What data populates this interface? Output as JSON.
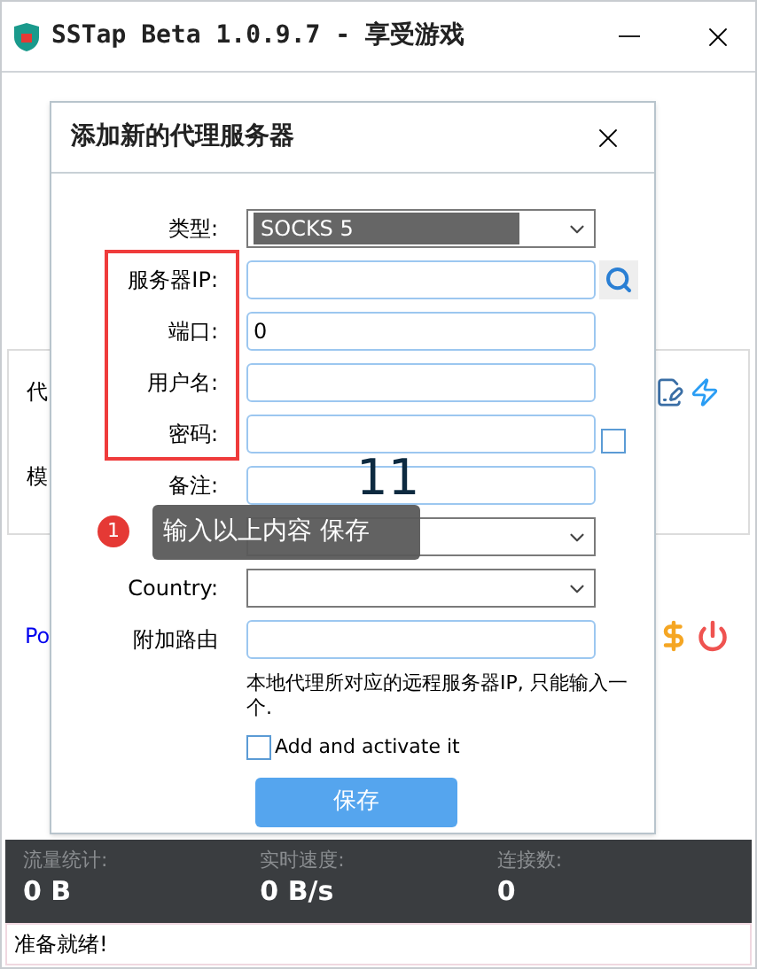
{
  "window": {
    "title": "SSTap Beta 1.0.9.7 - 享受游戏"
  },
  "main": {
    "proxy_label": "代",
    "mode_label": "模",
    "link_text": "Po"
  },
  "dialog": {
    "title": "添加新的代理服务器",
    "fields": [
      {
        "kind": "select",
        "label": "类型:",
        "value": "SOCKS 5",
        "focused": true
      },
      {
        "kind": "search",
        "label": "服务器IP:"
      },
      {
        "kind": "input",
        "label": "端口:",
        "value": "0"
      },
      {
        "kind": "input",
        "label": "用户名:"
      },
      {
        "kind": "password",
        "label": "密码:",
        "checked": false
      },
      {
        "kind": "input",
        "label": "备注:"
      },
      {
        "kind": "select"
      },
      {
        "kind": "select",
        "label": "Country:"
      },
      {
        "kind": "input",
        "label": "附加路由"
      }
    ],
    "note": "本地代理所对应的远程服务器IP, 只能输入一个.",
    "activate": {
      "label": "Add and activate it",
      "checked": false
    },
    "save_button": "保存"
  },
  "annotations": {
    "badge": "1",
    "tooltip": "输入以上内容 保存",
    "number": "11"
  },
  "stats": [
    {
      "label": "流量统计:",
      "value": "0 B"
    },
    {
      "label": "实时速度:",
      "value": "0 B/s"
    },
    {
      "label": "连接数:",
      "value": "0"
    }
  ],
  "status_bar": "准备就绪!"
}
